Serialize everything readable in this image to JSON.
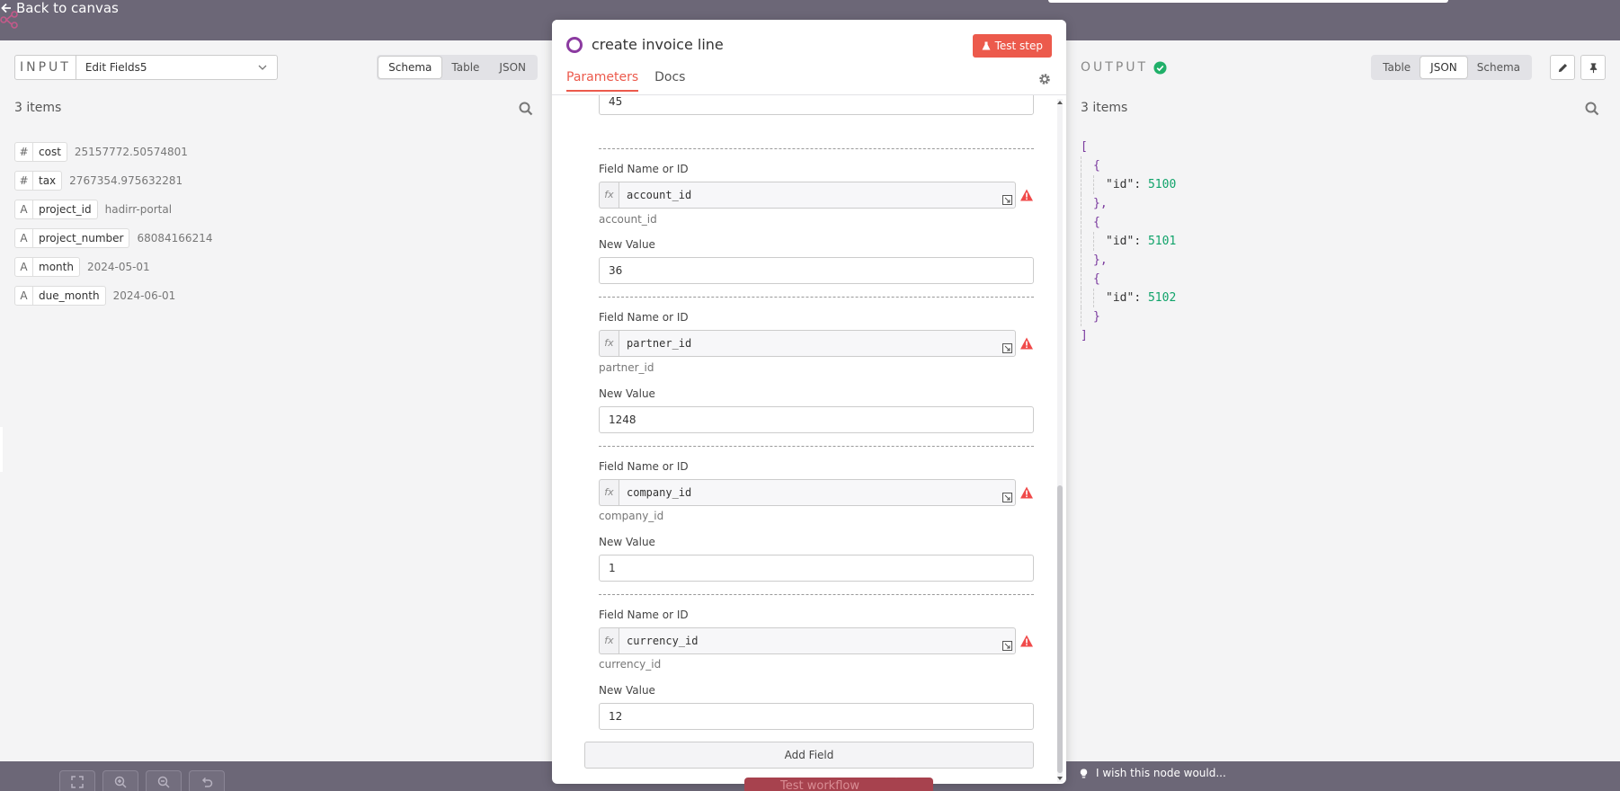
{
  "nav": {
    "back_label": "Back to canvas"
  },
  "input": {
    "title": "INPUT",
    "node": "Edit Fields5",
    "views": [
      "Schema",
      "Table",
      "JSON"
    ],
    "active_view": "Schema",
    "items_count": "3 items",
    "fields": [
      {
        "type": "#",
        "key": "cost",
        "value": "25157772.50574801"
      },
      {
        "type": "#",
        "key": "tax",
        "value": "2767354.975632281"
      },
      {
        "type": "A",
        "key": "project_id",
        "value": "hadirr-portal"
      },
      {
        "type": "A",
        "key": "project_number",
        "value": "68084166214"
      },
      {
        "type": "A",
        "key": "month",
        "value": "2024-05-01"
      },
      {
        "type": "A",
        "key": "due_month",
        "value": "2024-06-01"
      }
    ]
  },
  "node_panel": {
    "title": "create invoice line",
    "test_step_label": "Test step",
    "tabs": [
      "Parameters",
      "Docs"
    ],
    "active_tab": "Parameters",
    "top_value": "45",
    "field_name_label": "Field Name or ID",
    "new_value_label": "New Value",
    "fx_label": "fx",
    "fields": [
      {
        "expression": "account_id",
        "hint": "account_id",
        "value": "36"
      },
      {
        "expression": "partner_id",
        "hint": "partner_id",
        "value": "1248"
      },
      {
        "expression": "company_id",
        "hint": "company_id",
        "value": "1"
      },
      {
        "expression": "currency_id",
        "hint": "currency_id",
        "value": "12"
      }
    ],
    "add_field_label": "Add Field"
  },
  "output": {
    "title": "OUTPUT",
    "views": [
      "Table",
      "JSON",
      "Schema"
    ],
    "active_view": "JSON",
    "items_count": "3 items",
    "json_items": [
      {
        "key": "\"id\"",
        "value": "5100"
      },
      {
        "key": "\"id\"",
        "value": "5101"
      },
      {
        "key": "\"id\"",
        "value": "5102"
      }
    ]
  },
  "footer": {
    "test_workflow_label": "Test workflow",
    "wish_label": "I wish this node would..."
  },
  "colors": {
    "accent": "#ec5a4c",
    "success": "#20b069",
    "node_icon": "#8b3aa0",
    "json_bracket": "#7a3a9e",
    "json_number": "#10a36a"
  }
}
